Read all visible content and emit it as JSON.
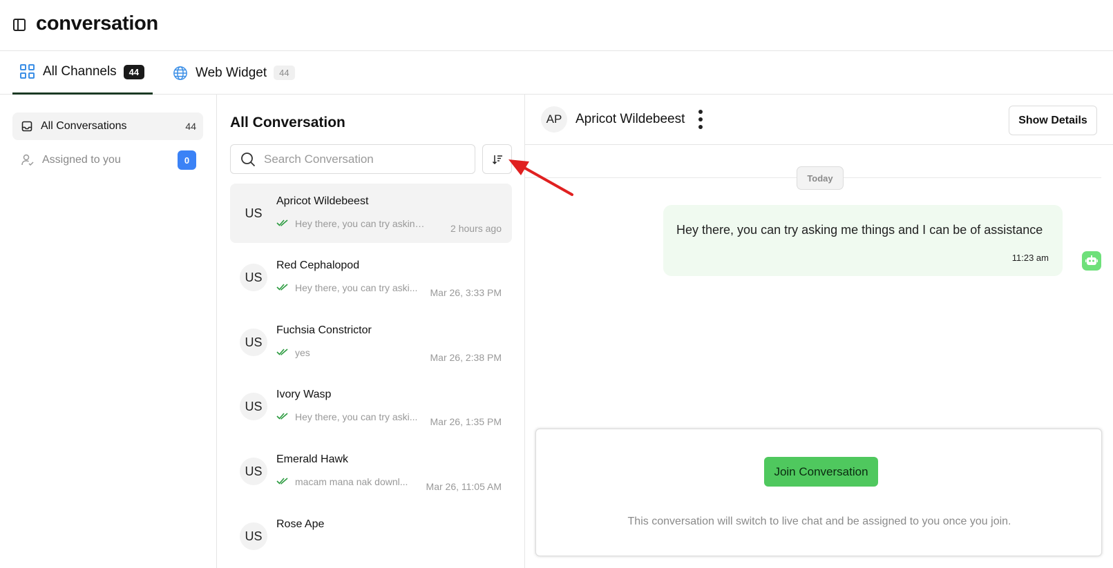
{
  "header": {
    "title": "conversation",
    "sidebar_toggle_icon": "sidebar-toggle-icon"
  },
  "tabs": [
    {
      "label": "All Channels",
      "count": "44",
      "icon": "grid-icon"
    },
    {
      "label": "Web Widget",
      "count": "44",
      "icon": "globe-icon"
    }
  ],
  "nav": {
    "all": {
      "label": "All Conversations",
      "count": "44",
      "icon": "inbox-icon"
    },
    "assigned": {
      "label": "Assigned to you",
      "count": "0",
      "icon": "user-check-icon"
    }
  },
  "list": {
    "title": "All Conversation",
    "search_placeholder": "Search Conversation",
    "sort_icon": "sort-descending-icon",
    "items": [
      {
        "avatar": "US",
        "name": "Apricot Wildebeest",
        "preview": "Hey there, you can try asking ...",
        "time": "2 hours ago"
      },
      {
        "avatar": "US",
        "name": "Red Cephalopod",
        "preview": "Hey there, you can try aski...",
        "time": "Mar 26, 3:33 PM"
      },
      {
        "avatar": "US",
        "name": "Fuchsia Constrictor",
        "preview": "yes",
        "time": "Mar 26, 2:38 PM"
      },
      {
        "avatar": "US",
        "name": "Ivory Wasp",
        "preview": "Hey there, you can try aski...",
        "time": "Mar 26, 1:35 PM"
      },
      {
        "avatar": "US",
        "name": "Emerald Hawk",
        "preview": "macam mana nak downl...",
        "time": "Mar 26, 11:05 AM"
      },
      {
        "avatar": "US",
        "name": "Rose Ape",
        "preview": "",
        "time": ""
      }
    ]
  },
  "chat": {
    "avatar": "AP",
    "name": "Apricot Wildebeest",
    "details_button": "Show Details",
    "day_label": "Today",
    "messages": [
      {
        "text": "Hey there, you can try asking me things and I can be of assistance",
        "time": "11:23 am",
        "sender_icon": "bot-icon"
      }
    ],
    "join_button": "Join Conversation",
    "join_note": "This conversation will switch to live chat and be assigned to you once you join."
  },
  "colors": {
    "accent_blue": "#3b82f6",
    "join_green": "#4fc85e",
    "bubble_bg": "#f0faf0",
    "annotation_red": "#e02020"
  }
}
